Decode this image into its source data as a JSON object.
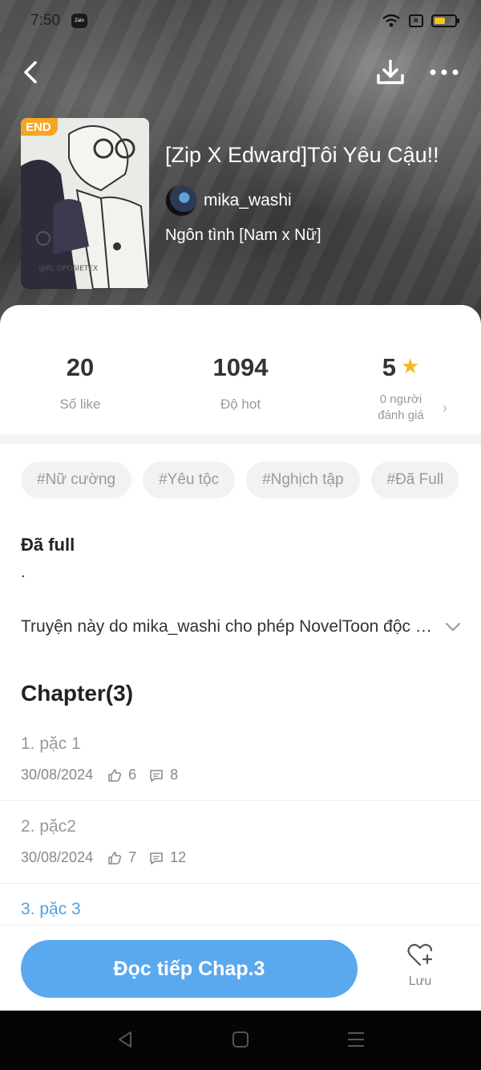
{
  "status_bar": {
    "time": "7:50",
    "app_badge": "Zalo",
    "battery_level": 0.55
  },
  "header": {
    "end_badge": "END",
    "title": "[Zip X Edward]Tôi Yêu Cậu!!",
    "author": "mika_washi",
    "genre": "Ngôn tình [Nam x Nữ]"
  },
  "stats": {
    "likes_value": "20",
    "likes_label": "Số like",
    "hot_value": "1094",
    "hot_label": "Độ hot",
    "rating_value": "5",
    "rating_label_line1": "0 người",
    "rating_label_line2": "đánh giá"
  },
  "tags": [
    "#Nữ cường",
    "#Yêu tộc",
    "#Nghịch tập",
    "#Đã Full"
  ],
  "description": {
    "status": "Đã full",
    "dot": ".",
    "text": "Truyện này do mika_washi cho phép NovelToon độc quyền phát hành"
  },
  "chapters": {
    "header": "Chapter(3)",
    "items": [
      {
        "title": "1. pặc 1",
        "date": "30/08/2024",
        "likes": "6",
        "comments": "8"
      },
      {
        "title": "2. pặc2",
        "date": "30/08/2024",
        "likes": "7",
        "comments": "12"
      },
      {
        "title": "3. pặc 3"
      }
    ]
  },
  "actions": {
    "read_button": "Đọc tiếp Chap.3",
    "save_label": "Lưu"
  },
  "colors": {
    "accent": "#5aa8ee",
    "active_chapter": "#4ea3e8",
    "star": "#f6b91a",
    "end_badge": "#f5a623"
  }
}
